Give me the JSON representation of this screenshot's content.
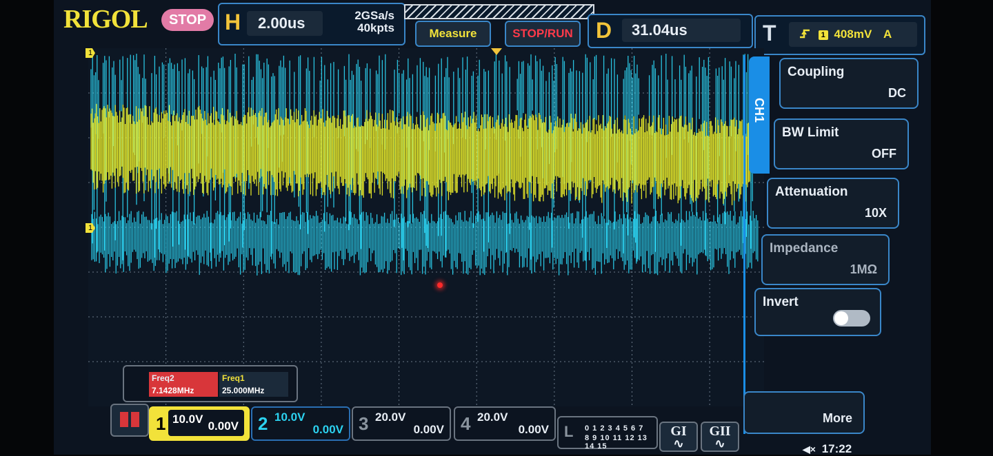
{
  "brand": "RIGOL",
  "run_status": "STOP",
  "horizontal": {
    "letter": "H",
    "timebase": "2.00us",
    "sample_rate": "2GSa/s",
    "memory_depth": "40kpts"
  },
  "buttons": {
    "measure": "Measure",
    "stop_run": "STOP/RUN"
  },
  "delay": {
    "letter": "D",
    "value": "31.04us"
  },
  "trigger": {
    "letter": "T",
    "slope_icon": "rising-edge-icon",
    "source": "1",
    "level": "408mV",
    "mode": "A"
  },
  "side_menu": {
    "tab_label": "CH1",
    "items": [
      {
        "label": "Coupling",
        "value": "DC"
      },
      {
        "label": "BW Limit",
        "value": "OFF"
      },
      {
        "label": "Attenuation",
        "value": "10X"
      },
      {
        "label": "Impedance",
        "value": "1MΩ"
      },
      {
        "label": "Invert",
        "value": ""
      },
      {
        "label": "More",
        "value": ""
      }
    ]
  },
  "markers": {
    "ch1_label": "1",
    "ch2_label": "1"
  },
  "measurements": [
    {
      "name": "Freq2",
      "value": "7.1428MHz"
    },
    {
      "name": "Freq1",
      "value": "25.000MHz"
    }
  ],
  "channels": [
    {
      "num": "1",
      "scale": "10.0V",
      "offset": "0.00V"
    },
    {
      "num": "2",
      "scale": "10.0V",
      "offset": "0.00V"
    },
    {
      "num": "3",
      "scale": "20.0V",
      "offset": "0.00V"
    },
    {
      "num": "4",
      "scale": "20.0V",
      "offset": "0.00V"
    }
  ],
  "logic": {
    "letter": "L",
    "row1": "0 1 2 3  4 5 6 7",
    "row2": "8 9 10 11 12 13 14 15"
  },
  "generators": [
    {
      "label": "GI"
    },
    {
      "label": "GII"
    }
  ],
  "clock": {
    "icon": "speaker-icon",
    "time": "17:22"
  },
  "colors": {
    "ch1": "#f2e23a",
    "ch2": "#2cd2f0",
    "accent": "#1a8ee6",
    "stop": "#e27ba6"
  }
}
